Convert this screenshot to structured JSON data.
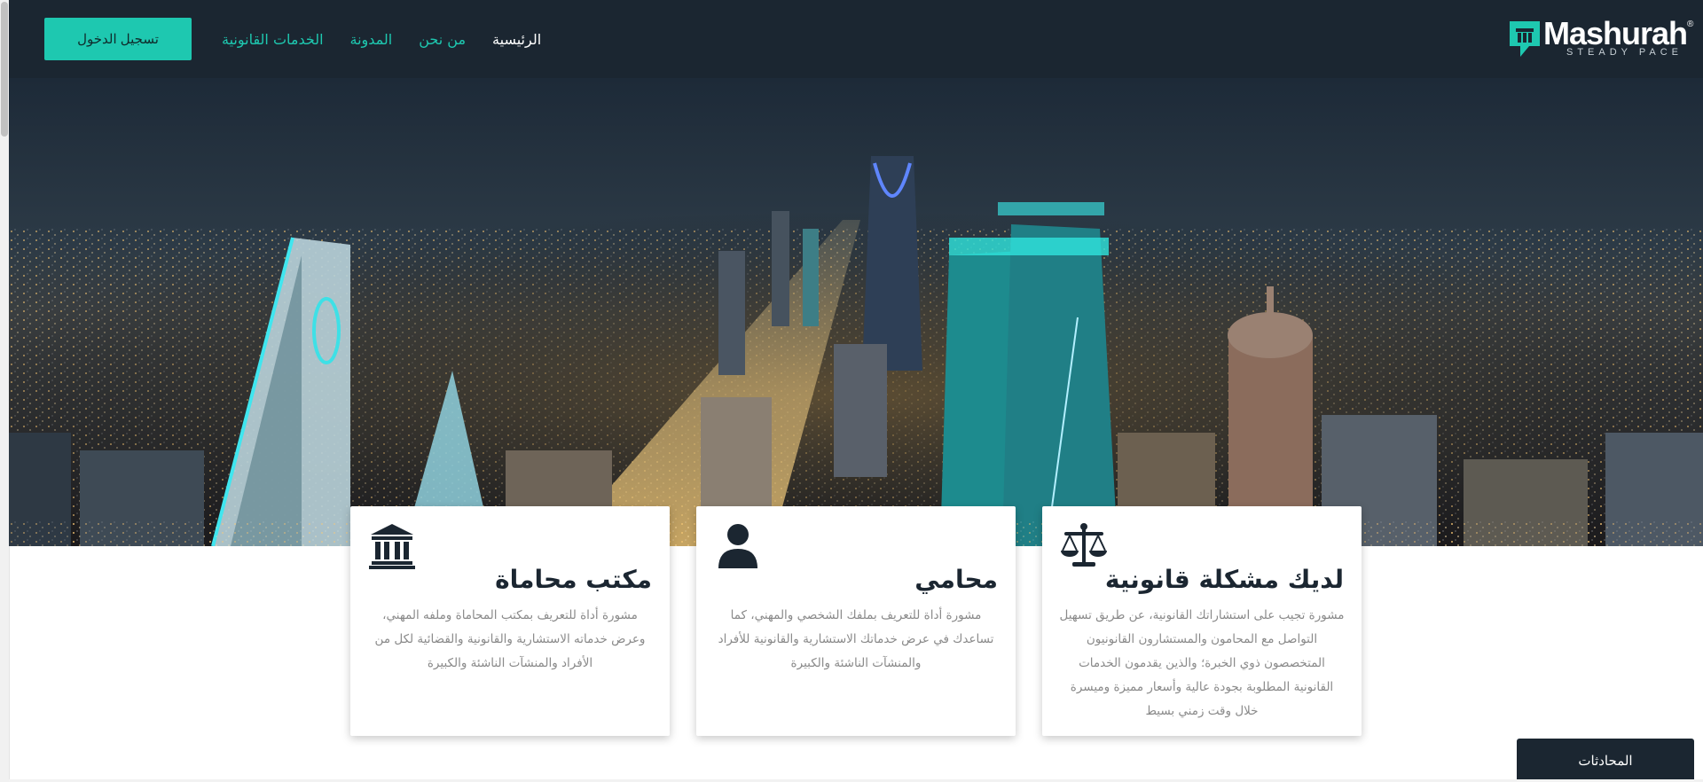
{
  "nav": {
    "login_label": "تسجيل الدخول",
    "links": [
      {
        "label": "الرئيسية",
        "active": true
      },
      {
        "label": "من نحن",
        "active": false
      },
      {
        "label": "المدونة",
        "active": false
      },
      {
        "label": "الخدمات القانونية",
        "active": false
      }
    ]
  },
  "brand": {
    "name": "Mashurah",
    "registered_mark": "®",
    "tagline": "STEADY PACE",
    "icon": "mashurah-logo-mark"
  },
  "hero": {
    "image": "night-city-skyline"
  },
  "cards": [
    {
      "icon": "scales-icon",
      "title": "لديك مشكلة قانونية",
      "text": "مشورة تجيب على استشاراتك القانونية، عن طريق تسهيل التواصل مع المحامون والمستشارون القانونيون المتخصصون ذوي الخبرة؛ والذين يقدمون الخدمات القانونية المطلوبة بجودة عالية وأسعار مميزة وميسرة خلال وقت زمني بسيط"
    },
    {
      "icon": "person-icon",
      "title": "محامي",
      "text": "مشورة أداة للتعريف بملفك الشخصي والمهني، كما تساعدك في عرض خدماتك الاستشارية والقانونية للأفراد والمنشآت الناشئة والكبيرة"
    },
    {
      "icon": "bank-building-icon",
      "title": "مكتب محاماة",
      "text": "مشورة أداة للتعريف بمكتب المحاماة وملفه المهني، وعرض خدماته الاستشارية والقانونية والقضائية لكل من الأفراد والمنشآت الناشئة والكبيرة"
    }
  ],
  "chat": {
    "label": "المحادثات"
  },
  "colors": {
    "navbar": "#1b2631",
    "accent": "#1ec8b0",
    "card_title": "#1b2631",
    "card_text": "#8a8a8a"
  }
}
